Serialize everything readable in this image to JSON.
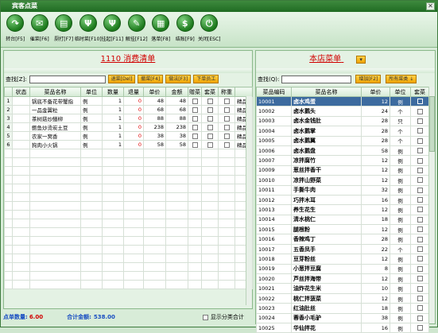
{
  "window": {
    "title": "宾客点菜",
    "close_glyph": "✕"
  },
  "toolbar": [
    {
      "label": "转台[F5]",
      "icon": "turn-icon",
      "glyph": "↷"
    },
    {
      "label": "催菜[F6]",
      "icon": "chat-icon",
      "glyph": "✉"
    },
    {
      "label": "厨打[F7]",
      "icon": "print-icon",
      "glyph": "▤"
    },
    {
      "label": "临时菜[F10]",
      "icon": "cutlery-icon",
      "glyph": "Ψ"
    },
    {
      "label": "挂起[F11]",
      "icon": "cutlery-icon",
      "glyph": "Ψ"
    },
    {
      "label": "解挂[F12]",
      "icon": "pencil-icon",
      "glyph": "✎"
    },
    {
      "label": "落单[F8]",
      "icon": "calculator-icon",
      "glyph": "▦"
    },
    {
      "label": "结账[F9]",
      "icon": "dollar-icon",
      "glyph": "$"
    },
    {
      "label": "关闭[ESC]",
      "icon": "power-icon",
      "glyph": "⏻"
    }
  ],
  "left": {
    "title": "1110 消费清单",
    "search_label": "查找[Z]:",
    "search_value": "",
    "buttons": [
      "退菜[Del]",
      "撤菜[F4]",
      "做法[F3]",
      "下单员工"
    ],
    "columns": [
      "",
      "状态",
      "菜品名称",
      "单位",
      "数量",
      "退量",
      "单价",
      "金额",
      "赠菜",
      "套菜",
      "称重",
      ""
    ],
    "rows": [
      {
        "idx": "1",
        "status": "",
        "name": "锅底不备花带蟹指",
        "unit": "例",
        "qty": "1",
        "ret": "0",
        "price": "48",
        "amount": "48",
        "extra": "精品"
      },
      {
        "idx": "2",
        "status": "",
        "name": "一品金翼粒",
        "unit": "例",
        "qty": "1",
        "ret": "0",
        "price": "68",
        "amount": "68",
        "extra": "精品"
      },
      {
        "idx": "3",
        "status": "",
        "name": "茶树菇炒鳝柳",
        "unit": "例",
        "qty": "1",
        "ret": "0",
        "price": "88",
        "amount": "88",
        "extra": "精品"
      },
      {
        "idx": "4",
        "status": "",
        "name": "鲍鱼炒烫炭土豆",
        "unit": "例",
        "qty": "1",
        "ret": "0",
        "price": "238",
        "amount": "238",
        "extra": "精品"
      },
      {
        "idx": "5",
        "status": "",
        "name": "农家一窝香",
        "unit": "例",
        "qty": "1",
        "ret": "0",
        "price": "38",
        "amount": "38",
        "extra": "精品"
      },
      {
        "idx": "6",
        "status": "",
        "name": "狗肉小火锅",
        "unit": "例",
        "qty": "1",
        "ret": "0",
        "price": "58",
        "amount": "58",
        "extra": "精品"
      }
    ],
    "status_qty_label": "点单数量:",
    "status_qty": "6.00",
    "status_total_label": "合计金额:",
    "status_total": "538.00",
    "show_category_label": "显示分类合计"
  },
  "right": {
    "title": "本店菜单",
    "dropdown_glyph": "▾",
    "search_label": "查找(Q):",
    "search_value": "",
    "buttons": [
      "增加[F2]",
      "所有菜类 ↓"
    ],
    "columns": [
      "菜品编码",
      "菜品名称",
      "单价",
      "单位",
      "套菜"
    ],
    "rows": [
      {
        "code": "10001",
        "name": "卤水鸡蛋",
        "price": "12",
        "unit": "例",
        "sel": true
      },
      {
        "code": "10002",
        "name": "卤水鹅头",
        "price": "24",
        "unit": "个"
      },
      {
        "code": "10003",
        "name": "卤水金钱肚",
        "price": "28",
        "unit": "只"
      },
      {
        "code": "10004",
        "name": "卤水鹅掌",
        "price": "28",
        "unit": "个"
      },
      {
        "code": "10005",
        "name": "卤水鹅翼",
        "price": "28",
        "unit": "个"
      },
      {
        "code": "10006",
        "name": "卤水鹅盘",
        "price": "58",
        "unit": "例"
      },
      {
        "code": "10007",
        "name": "凉拌腐竹",
        "price": "12",
        "unit": "例"
      },
      {
        "code": "10009",
        "name": "葱丝拌香干",
        "price": "12",
        "unit": "例"
      },
      {
        "code": "10010",
        "name": "凉拌山野菜",
        "price": "12",
        "unit": "例"
      },
      {
        "code": "10011",
        "name": "手撕牛肉",
        "price": "32",
        "unit": "例"
      },
      {
        "code": "10012",
        "name": "巧拌木耳",
        "price": "16",
        "unit": "例"
      },
      {
        "code": "10013",
        "name": "养生花生",
        "price": "12",
        "unit": "例"
      },
      {
        "code": "10014",
        "name": "清水桃仁",
        "price": "18",
        "unit": "例"
      },
      {
        "code": "10015",
        "name": "腿根粉",
        "price": "12",
        "unit": "例"
      },
      {
        "code": "10016",
        "name": "香辣鸡丁",
        "price": "28",
        "unit": "例"
      },
      {
        "code": "10017",
        "name": "五香凤手",
        "price": "22",
        "unit": "个"
      },
      {
        "code": "10018",
        "name": "豆芽粉丝",
        "price": "12",
        "unit": "例"
      },
      {
        "code": "10019",
        "name": "小葱拌豆腐",
        "price": "8",
        "unit": "例"
      },
      {
        "code": "10020",
        "name": "芦丝拌海带",
        "price": "12",
        "unit": "例"
      },
      {
        "code": "10021",
        "name": "油炸花生米",
        "price": "10",
        "unit": "例"
      },
      {
        "code": "10022",
        "name": "桃仁拌菠菜",
        "price": "12",
        "unit": "例"
      },
      {
        "code": "10023",
        "name": "红油肚丝",
        "price": "18",
        "unit": "例"
      },
      {
        "code": "10024",
        "name": "蓉香小毛驴",
        "price": "38",
        "unit": "例"
      },
      {
        "code": "10025",
        "name": "华仙拌花",
        "price": "16",
        "unit": "例"
      }
    ]
  }
}
